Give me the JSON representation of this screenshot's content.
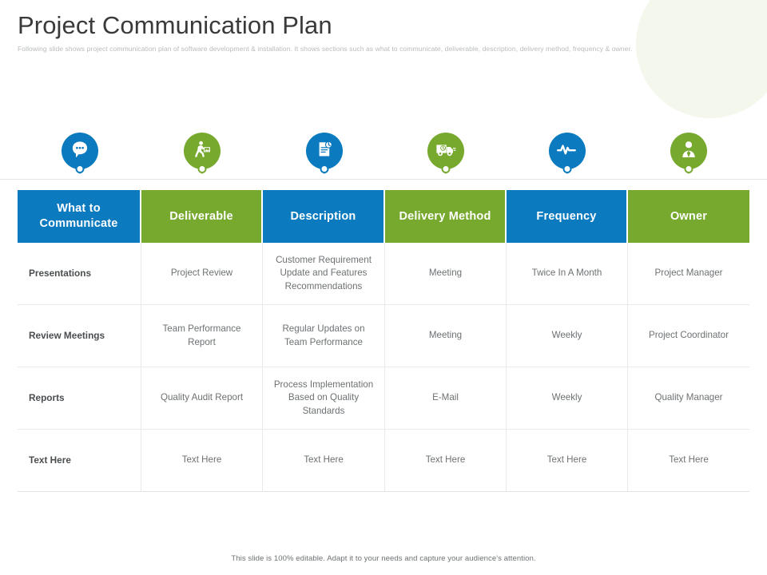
{
  "header": {
    "title": "Project Communication Plan",
    "subtitle": "Following slide shows project communication plan of software development & installation.  It shows sections such as what to communicate, deliverable, description, delivery method, frequency & owner."
  },
  "colors": {
    "blue": "#0b7abf",
    "green": "#76a92e",
    "header_text": "#ffffff",
    "body_text": "#6d7173",
    "title_text": "#3a3a3a",
    "subtitle_text": "#b9bcbd",
    "grid_line": "#e8eaeb",
    "deco_circle": "#f4f7ec"
  },
  "pins": [
    {
      "icon": "speech-bubble-icon",
      "color": "#0b7abf",
      "column": "What to Communicate"
    },
    {
      "icon": "delivery-person-icon",
      "color": "#76a92e",
      "column": "Deliverable"
    },
    {
      "icon": "document-clock-icon",
      "color": "#0b7abf",
      "column": "Description"
    },
    {
      "icon": "delivery-truck-icon",
      "color": "#76a92e",
      "column": "Delivery Method"
    },
    {
      "icon": "pulse-heartbeat-icon",
      "color": "#0b7abf",
      "column": "Frequency"
    },
    {
      "icon": "business-person-icon",
      "color": "#76a92e",
      "column": "Owner"
    }
  ],
  "table": {
    "columns": [
      {
        "label": "What to Communicate",
        "style": "blue"
      },
      {
        "label": "Deliverable",
        "style": "green"
      },
      {
        "label": "Description",
        "style": "blue"
      },
      {
        "label": "Delivery Method",
        "style": "green"
      },
      {
        "label": "Frequency",
        "style": "blue"
      },
      {
        "label": "Owner",
        "style": "green"
      }
    ],
    "rows": [
      {
        "c0": "Presentations",
        "c1": "Project Review",
        "c2": "Customer Requirement Update and Features Recommendations",
        "c3": "Meeting",
        "c4": "Twice In A Month",
        "c5": "Project Manager"
      },
      {
        "c0": "Review Meetings",
        "c1": "Team Performance Report",
        "c2": "Regular Updates on Team Performance",
        "c3": "Meeting",
        "c4": "Weekly",
        "c5": "Project Coordinator"
      },
      {
        "c0": "Reports",
        "c1": "Quality Audit Report",
        "c2": "Process Implementation Based on Quality Standards",
        "c3": "E-Mail",
        "c4": "Weekly",
        "c5": "Quality Manager"
      },
      {
        "c0": "Text Here",
        "c1": "Text Here",
        "c2": "Text Here",
        "c3": "Text Here",
        "c4": "Text Here",
        "c5": "Text Here"
      }
    ]
  },
  "footer": {
    "note": "This slide is 100% editable.  Adapt it to your needs and capture your audience's attention."
  }
}
